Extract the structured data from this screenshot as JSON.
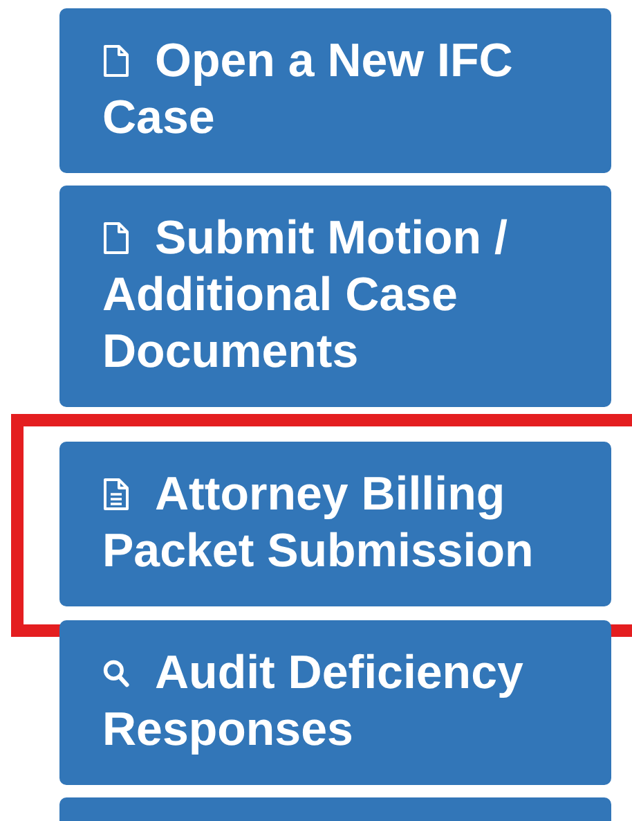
{
  "menu": [
    {
      "kind": "file",
      "label": "Open a New IFC Case",
      "highlighted": false
    },
    {
      "kind": "file",
      "label": "Submit Motion / Additional Case Documents",
      "highlighted": false
    },
    {
      "kind": "document",
      "label": "Attorney Billing Packet Submission",
      "highlighted": true
    },
    {
      "kind": "search",
      "label": "Audit Deficiency Responses",
      "highlighted": false
    },
    {
      "kind": "cut-off"
    }
  ]
}
